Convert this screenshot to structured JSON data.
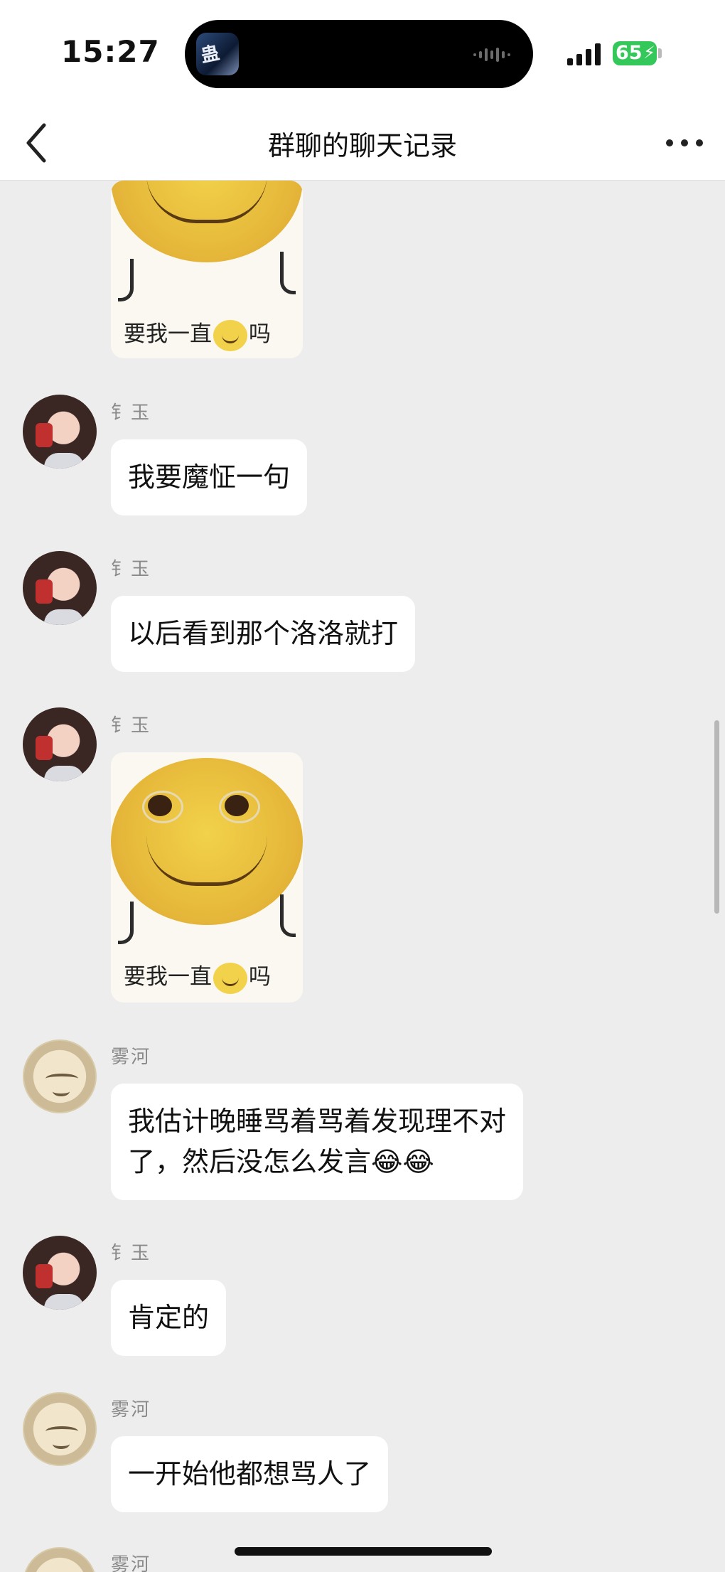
{
  "status_bar": {
    "time": "15:27",
    "battery": "65",
    "island_app_glyph": "蛊",
    "colors": {
      "battery": "#34c759"
    }
  },
  "nav": {
    "title": "群聊的聊天记录",
    "back_icon": "chevron-left-icon",
    "more_icon": "more-dots-icon"
  },
  "sticker_caption": {
    "before": "要我一直",
    "after": "吗"
  },
  "messages": [
    {
      "type": "sticker",
      "sender": ""
    },
    {
      "type": "text",
      "sender": "钅玉",
      "text": "我要魔怔一句"
    },
    {
      "type": "text",
      "sender": "钅玉",
      "text": "以后看到那个洛洛就打"
    },
    {
      "type": "sticker",
      "sender": "钅玉"
    },
    {
      "type": "text",
      "sender": "雾河",
      "text": "我估计晚睡骂着骂着发现理不对\n了，然后没怎么发言😂😂"
    },
    {
      "type": "text",
      "sender": "钅玉",
      "text": "肯定的"
    },
    {
      "type": "text",
      "sender": "雾河",
      "text": "一开始他都想骂人了"
    },
    {
      "type": "partial",
      "sender": "雾河"
    }
  ],
  "colors": {
    "background": "#ededed",
    "bubble": "#ffffff",
    "sender": "#8a8a8a"
  }
}
